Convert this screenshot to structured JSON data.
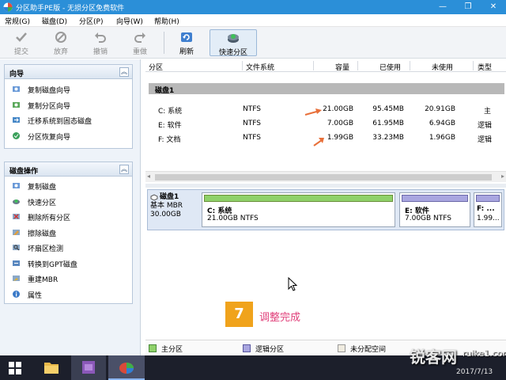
{
  "window": {
    "title": "分区助手PE版 - 无损分区免费软件",
    "controls": {
      "minimize": "—",
      "restore": "❐",
      "close": "✕"
    }
  },
  "menu": [
    "常规(G)",
    "磁盘(D)",
    "分区(P)",
    "向导(W)",
    "帮助(H)"
  ],
  "toolbar": {
    "submit": "提交",
    "discard": "放弃",
    "undo": "撤销",
    "redo": "重做",
    "refresh": "刷新",
    "quick_partition": "快速分区"
  },
  "wizard": {
    "title": "向导",
    "items": [
      "复制磁盘向导",
      "复制分区向导",
      "迁移系统到固态磁盘",
      "分区恢复向导"
    ]
  },
  "disk_ops": {
    "title": "磁盘操作",
    "items": [
      "复制磁盘",
      "快速分区",
      "删除所有分区",
      "擦除磁盘",
      "坏扇区检测",
      "转换到GPT磁盘",
      "重建MBR",
      "属性"
    ]
  },
  "partition_table": {
    "headers": [
      "分区",
      "文件系统",
      "容量",
      "已使用",
      "未使用",
      "类型"
    ],
    "disk_label": "磁盘1",
    "rows": [
      {
        "name": "C: 系统",
        "fs": "NTFS",
        "capacity": "21.00GB",
        "used": "95.45MB",
        "free": "20.91GB",
        "type": "主"
      },
      {
        "name": "E: 软件",
        "fs": "NTFS",
        "capacity": "7.00GB",
        "used": "61.95MB",
        "free": "6.94GB",
        "type": "逻辑"
      },
      {
        "name": "F: 文档",
        "fs": "NTFS",
        "capacity": "1.99GB",
        "used": "33.23MB",
        "free": "1.96GB",
        "type": "逻辑"
      }
    ]
  },
  "disk_map": {
    "disk_name": "磁盘1",
    "disk_type": "基本 MBR",
    "disk_size": "30.00GB",
    "partitions": [
      {
        "label": "C: 系统",
        "sub": "21.00GB NTFS",
        "kind": "primary"
      },
      {
        "label": "E: 软件",
        "sub": "7.00GB NTFS",
        "kind": "logical"
      },
      {
        "label": "F: ...",
        "sub": "1.99...",
        "kind": "logical"
      }
    ]
  },
  "step": {
    "number": "7",
    "caption": "调整完成"
  },
  "legend": {
    "primary": "主分区",
    "logical": "逻辑分区",
    "unallocated": "未分配空间"
  },
  "taskbar": {
    "date": "2017/7/13"
  },
  "watermark": {
    "text": "锐客网",
    "domain": "ruike1.com"
  },
  "colors": {
    "titlebar": "#2b8fd8",
    "primary": "#8fd16a",
    "logical": "#a9a6e0",
    "unallocated": "#f0ece0",
    "accent_arrow": "#e8703a",
    "badge": "#f0a31c",
    "badge_caption": "#e0407a"
  }
}
